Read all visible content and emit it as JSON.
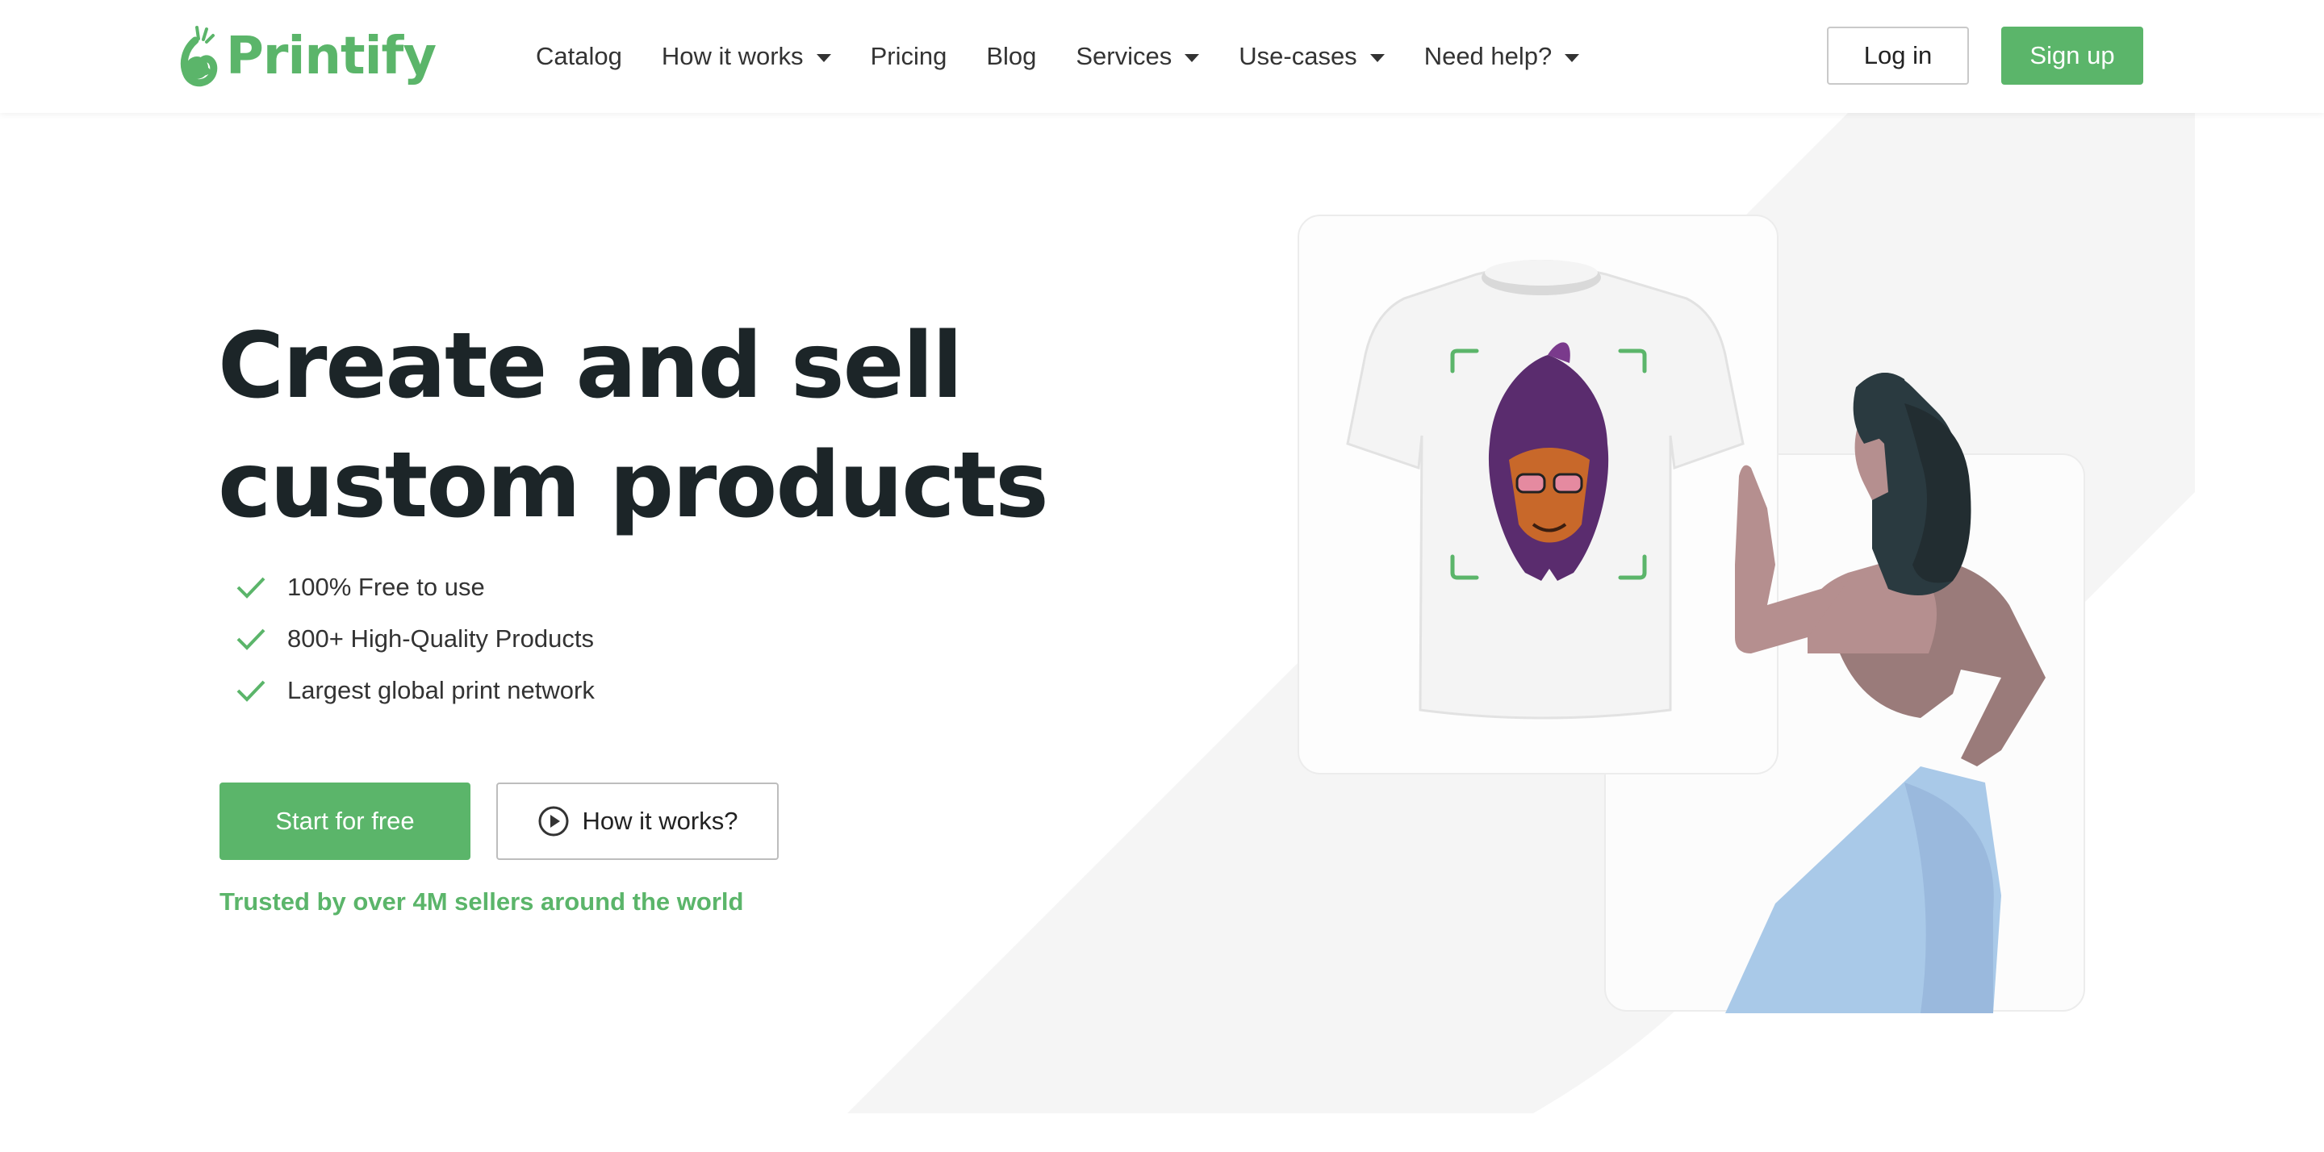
{
  "brand": {
    "name": "Printify",
    "color": "#5bb56a",
    "logo_icon": "printify-logo-icon"
  },
  "nav": {
    "items": [
      {
        "label": "Catalog",
        "has_dropdown": false
      },
      {
        "label": "How it works",
        "has_dropdown": true
      },
      {
        "label": "Pricing",
        "has_dropdown": false
      },
      {
        "label": "Blog",
        "has_dropdown": false
      },
      {
        "label": "Services",
        "has_dropdown": true
      },
      {
        "label": "Use-cases",
        "has_dropdown": true
      },
      {
        "label": "Need help?",
        "has_dropdown": true
      }
    ],
    "login_label": "Log in",
    "signup_label": "Sign up"
  },
  "hero": {
    "headline_line1": "Create and sell",
    "headline_line2": "custom products",
    "features": [
      "100% Free to use",
      "800+ High-Quality Products",
      "Largest global print network"
    ],
    "cta_primary": "Start for free",
    "cta_secondary": "How it works?",
    "trusted_text": "Trusted by over 4M sellers around the world"
  },
  "colors": {
    "accent": "#5bb56a",
    "headline": "#1c2528",
    "background_shape": "#f5f5f5",
    "skirt": "#a9c9e8"
  },
  "icons": {
    "feature_check": "check-icon",
    "dropdown": "chevron-down-icon",
    "play": "play-circle-icon"
  }
}
